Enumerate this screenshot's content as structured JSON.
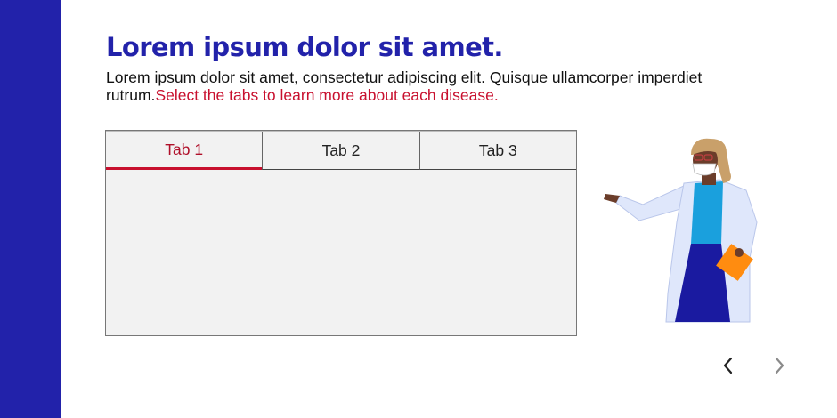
{
  "page": {
    "title": "Lorem ipsum dolor sit amet.",
    "description": "Lorem ipsum dolor sit amet, consectetur adipiscing elit. Quisque ullamcorper imperdiet rutrum.",
    "instruction": "Select the tabs to learn more about each disease."
  },
  "tabs": [
    {
      "label": "Tab 1",
      "active": true
    },
    {
      "label": "Tab 2",
      "active": false
    },
    {
      "label": "Tab 3",
      "active": false
    }
  ],
  "illustration": {
    "icon": "doctor-illustration"
  },
  "navigation": {
    "prev": {
      "icon": "chevron-left-icon",
      "enabled": true
    },
    "next": {
      "icon": "chevron-right-icon",
      "enabled": false
    }
  },
  "colors": {
    "brand": "#2222aa",
    "accent": "#c8102e"
  }
}
